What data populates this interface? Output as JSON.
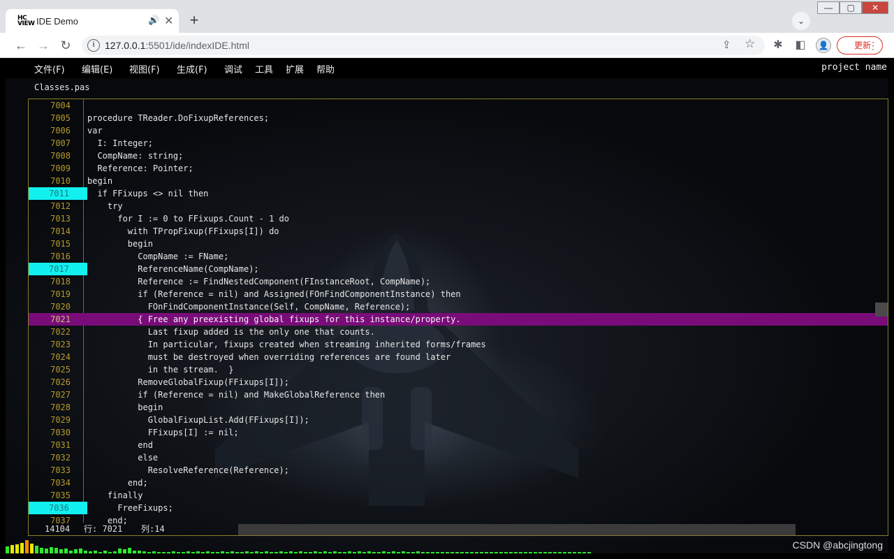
{
  "browser": {
    "tab_title": "IDE Demo",
    "favicon_text": "HC\nVIEW",
    "url_host": "127.0.0.1",
    "url_rest": ":5501/ide/indexIDE.html",
    "update_label": "更新"
  },
  "ide": {
    "menu": [
      "文件(F)",
      "编辑(E)",
      "视图(F)",
      "生成(F)",
      "调试",
      "工具",
      "扩展",
      "帮助"
    ],
    "project_name": "project name",
    "file_tab": "Classes.pas",
    "current_line": 7021,
    "breakpoints": [
      7011,
      7017,
      7036
    ],
    "lines": [
      {
        "n": 7004,
        "t": ""
      },
      {
        "n": 7005,
        "t": "procedure TReader.DoFixupReferences;"
      },
      {
        "n": 7006,
        "t": "var"
      },
      {
        "n": 7007,
        "t": "  I: Integer;"
      },
      {
        "n": 7008,
        "t": "  CompName: string;"
      },
      {
        "n": 7009,
        "t": "  Reference: Pointer;"
      },
      {
        "n": 7010,
        "t": "begin"
      },
      {
        "n": 7011,
        "t": "  if FFixups <> nil then"
      },
      {
        "n": 7012,
        "t": "    try"
      },
      {
        "n": 7013,
        "t": "      for I := 0 to FFixups.Count - 1 do"
      },
      {
        "n": 7014,
        "t": "        with TPropFixup(FFixups[I]) do"
      },
      {
        "n": 7015,
        "t": "        begin"
      },
      {
        "n": 7016,
        "t": "          CompName := FName;"
      },
      {
        "n": 7017,
        "t": "          ReferenceName(CompName);"
      },
      {
        "n": 7018,
        "t": "          Reference := FindNestedComponent(FInstanceRoot, CompName);"
      },
      {
        "n": 7019,
        "t": "          if (Reference = nil) and Assigned(FOnFindComponentInstance) then"
      },
      {
        "n": 7020,
        "t": "            FOnFindComponentInstance(Self, CompName, Reference);"
      },
      {
        "n": 7021,
        "t": "          { Free any preexisting global fixups for this instance/property."
      },
      {
        "n": 7022,
        "t": "            Last fixup added is the only one that counts."
      },
      {
        "n": 7023,
        "t": "            In particular, fixups created when streaming inherited forms/frames"
      },
      {
        "n": 7024,
        "t": "            must be destroyed when overriding references are found later"
      },
      {
        "n": 7025,
        "t": "            in the stream.  }"
      },
      {
        "n": 7026,
        "t": "          RemoveGlobalFixup(FFixups[I]);"
      },
      {
        "n": 7027,
        "t": "          if (Reference = nil) and MakeGlobalReference then"
      },
      {
        "n": 7028,
        "t": "          begin"
      },
      {
        "n": 7029,
        "t": "            GlobalFixupList.Add(FFixups[I]);"
      },
      {
        "n": 7030,
        "t": "            FFixups[I] := nil;"
      },
      {
        "n": 7031,
        "t": "          end"
      },
      {
        "n": 7032,
        "t": "          else"
      },
      {
        "n": 7033,
        "t": "            ResolveReference(Reference);"
      },
      {
        "n": 7034,
        "t": "        end;"
      },
      {
        "n": 7035,
        "t": "    finally"
      },
      {
        "n": 7036,
        "t": "      FreeFixups;"
      },
      {
        "n": 7037,
        "t": "    end;"
      }
    ],
    "status": {
      "total_lines": "14104",
      "row": "行: 7021",
      "col": "列:14"
    },
    "colors": {
      "breakpoint": "#12f0f0",
      "current_line": "#7a0c7a",
      "line_number": "#b59a2c"
    },
    "meter_levels": [
      0.45,
      0.55,
      0.6,
      0.7,
      0.85,
      0.65,
      0.5,
      0.35,
      0.3,
      0.4,
      0.35,
      0.25,
      0.3,
      0.2,
      0.25,
      0.3,
      0.2,
      0.15,
      0.2,
      0.1,
      0.2,
      0.1,
      0.15,
      0.3,
      0.25,
      0.35,
      0.2,
      0.2,
      0.15,
      0.1,
      0.15,
      0.1,
      0.1,
      0.1,
      0.12,
      0.1,
      0.1,
      0.12,
      0.1,
      0.12,
      0.1,
      0.12,
      0.1,
      0.1,
      0.12,
      0.1,
      0.12,
      0.1,
      0.1,
      0.12,
      0.1,
      0.12,
      0.1,
      0.12,
      0.1,
      0.1,
      0.12,
      0.1,
      0.12,
      0.1,
      0.12,
      0.1,
      0.1,
      0.12,
      0.1,
      0.12,
      0.1,
      0.12,
      0.1,
      0.1,
      0.12,
      0.1,
      0.12,
      0.1,
      0.12,
      0.1,
      0.1,
      0.12,
      0.1,
      0.12,
      0.1,
      0.12,
      0.1,
      0.1,
      0.12,
      0.1,
      0.1,
      0.1,
      0.1,
      0.1,
      0.1,
      0.1,
      0.1,
      0.1,
      0.1,
      0.1,
      0.1,
      0.1,
      0.1,
      0.1,
      0.1,
      0.1,
      0.1,
      0.1,
      0.1,
      0.1,
      0.1,
      0.1,
      0.1,
      0.1,
      0.1,
      0.1,
      0.1,
      0.1,
      0.1,
      0.1,
      0.1,
      0.1,
      0.1,
      0.1
    ]
  },
  "watermark": "CSDN @abcjingtong"
}
